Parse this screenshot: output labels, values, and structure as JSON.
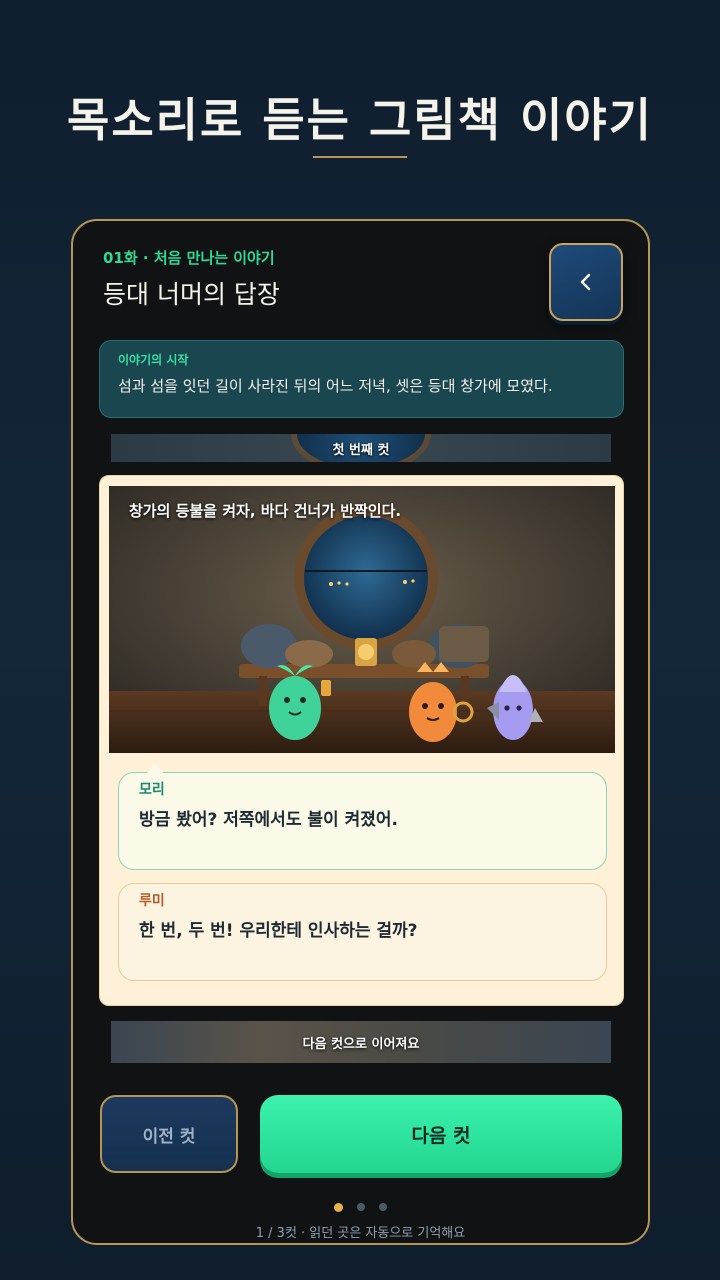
{
  "headline": "목소리로 듣는 그림책 이야기",
  "episode": {
    "label": "01화 · 처음 만나는 이야기",
    "title": "등대 너머의 답장"
  },
  "back_icon": "chevron-left-icon",
  "synopsis": {
    "label": "이야기의 시작",
    "text": "섬과 섬을 잇던 길이 사라진 뒤의 어느 저녁, 셋은 등대 창가에 모였다."
  },
  "cuts": {
    "previous_strip": "첫 번째 컷",
    "next_strip": "다음 컷으로 이어져요"
  },
  "scene": {
    "caption": "창가의 등불을 켜자, 바다 건너가 반짝인다."
  },
  "dialogue": [
    {
      "speaker": "모리",
      "line": "방금 봤어? 저쪽에서도 불이 켜졌어."
    },
    {
      "speaker": "루미",
      "line": "한 번, 두 번! 우리한테 인사하는 걸까?"
    }
  ],
  "buttons": {
    "prev": "이전 컷",
    "next": "다음 컷"
  },
  "progress": {
    "text": "1 / 3컷 · 읽던 곳은 자동으로 기억해요",
    "current": 1,
    "total": 3
  },
  "colors": {
    "accent_green": "#2fd99a",
    "gold_border": "#b79654",
    "background": "#13263a"
  }
}
